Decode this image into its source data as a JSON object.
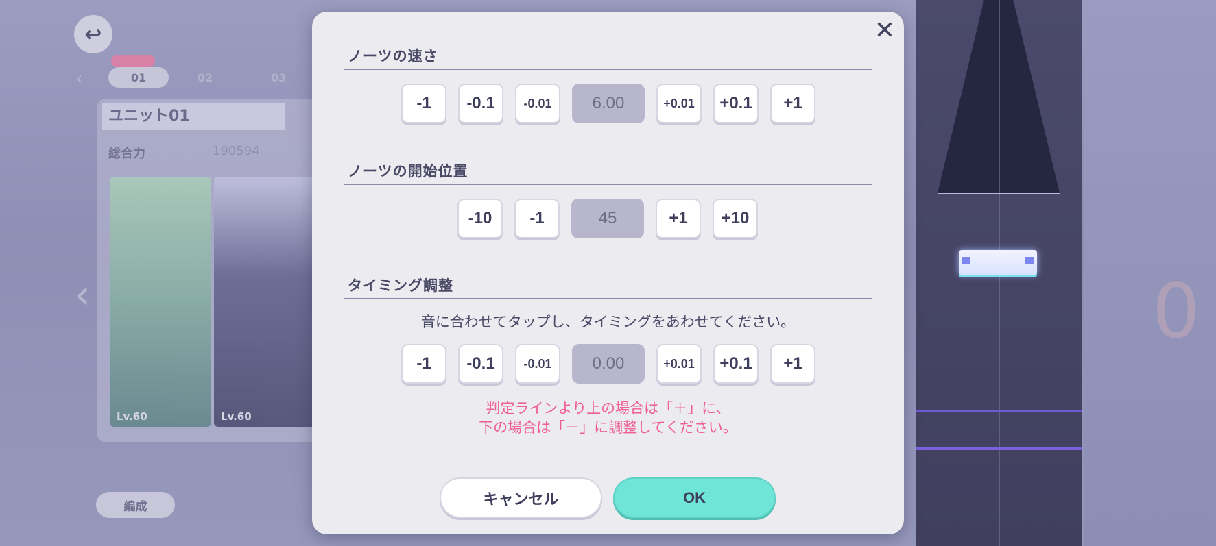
{
  "background": {
    "unit_tabs": [
      "01",
      "02",
      "03"
    ],
    "unit_title": "ユニット01",
    "power_label": "総合力",
    "power_value": "190594",
    "card_levels": [
      "Lv.60",
      "Lv.60"
    ],
    "detail_button": "編成",
    "deco_number": "0"
  },
  "dialog": {
    "close_label": "✕",
    "note_speed": {
      "title": "ノーツの速さ",
      "buttons_minus": [
        "-1",
        "-0.1",
        "-0.01"
      ],
      "value": "6.00",
      "buttons_plus": [
        "+0.01",
        "+0.1",
        "+1"
      ]
    },
    "note_start": {
      "title": "ノーツの開始位置",
      "buttons_minus": [
        "-10",
        "-1"
      ],
      "value": "45",
      "buttons_plus": [
        "+1",
        "+10"
      ]
    },
    "timing": {
      "title": "タイミング調整",
      "hint": "音に合わせてタップし、タイミングをあわせてください。",
      "buttons_minus": [
        "-1",
        "-0.1",
        "-0.01"
      ],
      "value": "0.00",
      "buttons_plus": [
        "+0.01",
        "+0.1",
        "+1"
      ],
      "warning_line1": "判定ラインより上の場合は「＋」に、",
      "warning_line2": "下の場合は「－」に調整してください。"
    },
    "cancel_label": "キャンセル",
    "ok_label": "OK"
  },
  "colors": {
    "dialog_bg": "#ebebf0",
    "ok_button": "#6fe5d7",
    "warning_text": "#ef5f8f",
    "value_box": "#b7b6cc"
  }
}
